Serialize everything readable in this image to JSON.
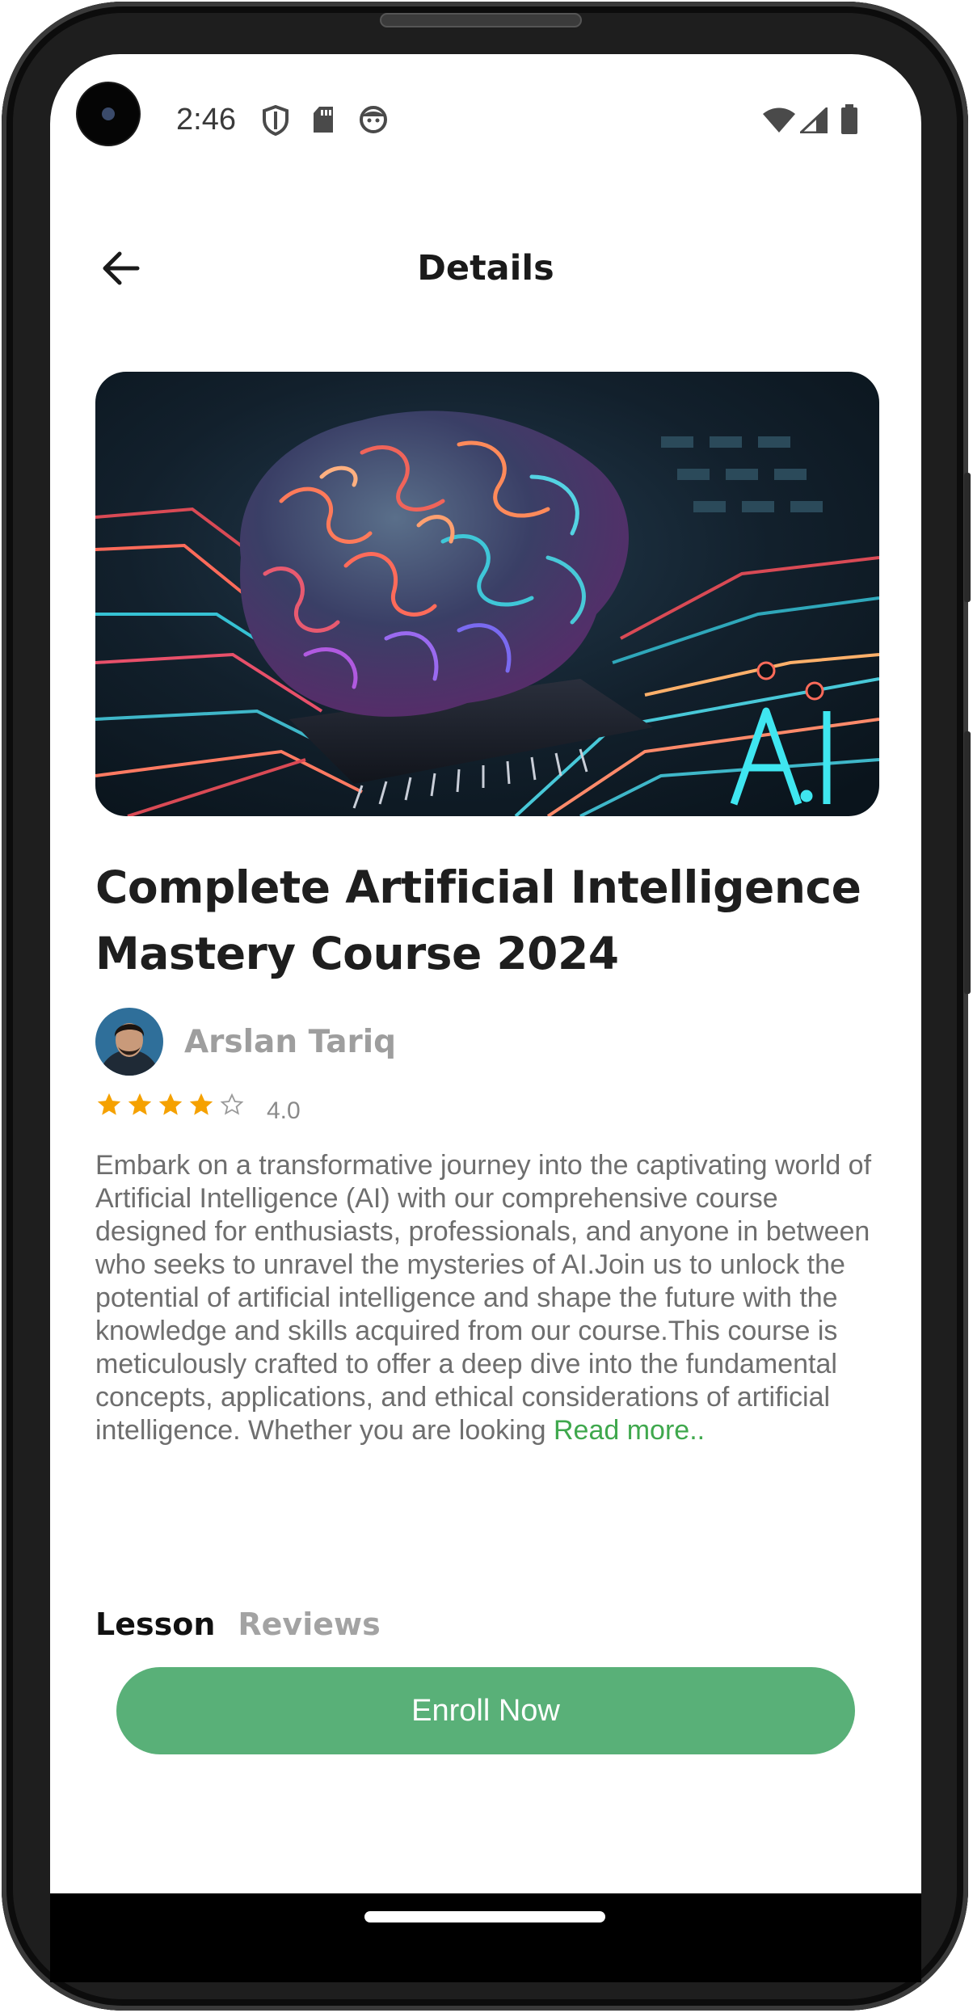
{
  "status_bar": {
    "time": "2:46",
    "icons": [
      "shield-icon",
      "sd-card-icon",
      "face-icon",
      "wifi-icon",
      "signal-icon",
      "battery-icon"
    ]
  },
  "header": {
    "title": "Details",
    "back_icon": "arrow-left-icon"
  },
  "course": {
    "hero_image": "brain-circuit-ai-image",
    "hero_text": "AI",
    "title": "Complete Artificial Intelligence Mastery Course 2024",
    "instructor": "Arslan Tariq",
    "rating": {
      "value": "4.0",
      "stars_filled": 4,
      "stars_total": 5
    },
    "description": "Embark on a transformative journey into the captivating world of Artificial Intelligence (AI) with our comprehensive course designed for enthusiasts, professionals, and anyone in between who seeks to unravel the mysteries of AI.Join us to unlock the potential of artificial intelligence and shape the future with the knowledge and skills acquired from our course.This course is meticulously crafted to offer a deep dive into the fundamental concepts, applications, and ethical considerations of artificial intelligence. Whether you are looking ",
    "read_more": "Read more.."
  },
  "tabs": [
    {
      "label": "Lesson",
      "active": true
    },
    {
      "label": "Reviews",
      "active": false
    }
  ],
  "cta": {
    "label": "Enroll Now"
  },
  "colors": {
    "accent": "#59b078",
    "link": "#3fa84d",
    "star": "#f5a100"
  }
}
